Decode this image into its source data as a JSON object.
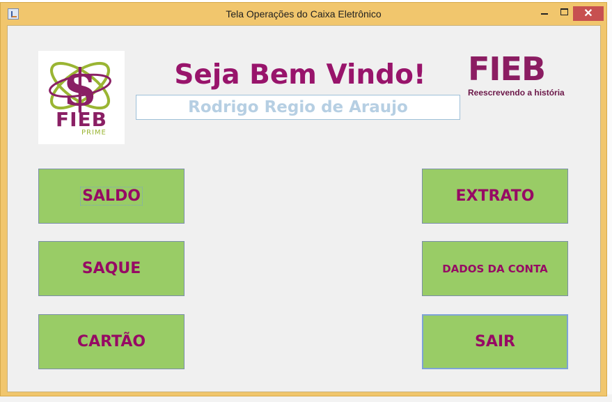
{
  "window": {
    "title": "Tela Operações do Caixa Eletrônico",
    "close_symbol": "✕"
  },
  "header": {
    "welcome": "Seja Bem Vindo!",
    "user_name": "Rodrigo Regio de Araujo",
    "logo_left_text": "FIEB",
    "logo_left_sub": "PRIME",
    "logo_right_text": "FIEB",
    "logo_right_tagline": "Reescrevendo a história"
  },
  "buttons": {
    "saldo": "SALDO",
    "saque": "SAQUE",
    "cartao": "CARTÃO",
    "extrato": "EXTRATO",
    "dados_conta": "DADOS DA CONTA",
    "sair": "SAIR"
  },
  "colors": {
    "button_bg": "#99CC66",
    "button_text": "#960A64",
    "brand_magenta": "#98146B",
    "brand_green": "#9AB533",
    "window_frame": "#F1C66D"
  },
  "icons": {
    "app": "java-app-icon",
    "minimize": "minimize-icon",
    "maximize": "maximize-icon",
    "close": "close-icon",
    "logo_left": "dollar-atom-logo"
  }
}
